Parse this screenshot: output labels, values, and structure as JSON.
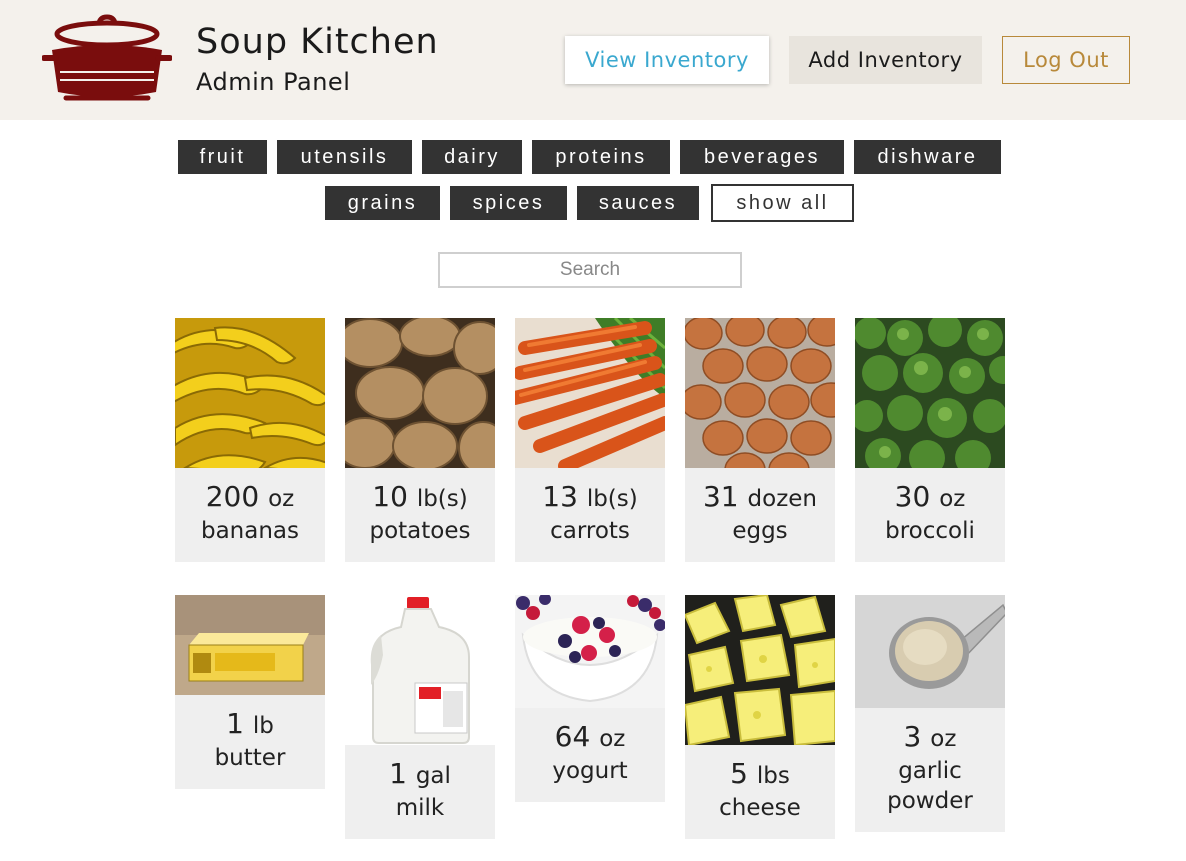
{
  "app": {
    "title": "Soup Kitchen",
    "subtitle": "Admin Panel"
  },
  "nav": {
    "view_inventory": "View Inventory",
    "add_inventory": "Add Inventory",
    "log_out": "Log Out"
  },
  "filters": [
    "fruit",
    "utensils",
    "dairy",
    "proteins",
    "beverages",
    "dishware",
    "grains",
    "spices",
    "sauces",
    "show all"
  ],
  "active_filter": "show all",
  "search": {
    "placeholder": "Search",
    "value": ""
  },
  "items": [
    {
      "qty": "200",
      "unit": "oz",
      "name": "bananas",
      "image": "bananas"
    },
    {
      "qty": "10",
      "unit": "lb(s)",
      "name": "potatoes",
      "image": "potatoes"
    },
    {
      "qty": "13",
      "unit": "lb(s)",
      "name": "carrots",
      "image": "carrots"
    },
    {
      "qty": "31",
      "unit": "dozen",
      "name": "eggs",
      "image": "eggs"
    },
    {
      "qty": "30",
      "unit": "oz",
      "name": "broccoli",
      "image": "broccoli"
    },
    {
      "qty": "1",
      "unit": "lb",
      "name": "butter",
      "image": "butter"
    },
    {
      "qty": "1",
      "unit": "gal",
      "name": "milk",
      "image": "milk"
    },
    {
      "qty": "64",
      "unit": "oz",
      "name": "yogurt",
      "image": "yogurt"
    },
    {
      "qty": "5",
      "unit": "lbs",
      "name": "cheese",
      "image": "cheese"
    },
    {
      "qty": "3",
      "unit": "oz",
      "name": "garlic powder",
      "image": "garlic-powder"
    }
  ],
  "colors": {
    "header_bg": "#f4f1ec",
    "chip_bg": "#333333",
    "accent_blue": "#3aa8cf",
    "accent_gold": "#b8893a",
    "pot_red": "#7a0d0d",
    "card_bg": "#efefef"
  },
  "icons": {
    "logo": "soup-pot-icon"
  }
}
